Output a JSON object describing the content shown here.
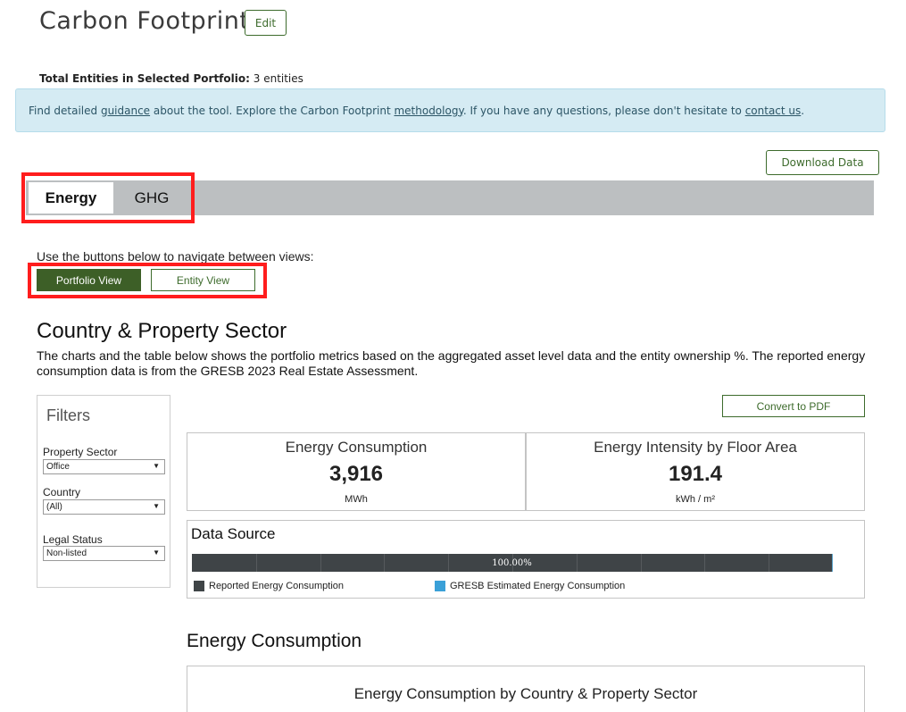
{
  "header": {
    "title": "Carbon Footprint",
    "edit_label": "Edit"
  },
  "summary": {
    "label": "Total Entities in Selected Portfolio:",
    "value": "3 entities"
  },
  "banner": {
    "t1": "Find detailed ",
    "link_guidance": "guidance",
    "t2": " about the tool. Explore the Carbon Footprint ",
    "link_methodology": "methodology",
    "t3": ". If you have any questions, please don't hesitate to ",
    "link_contact": "contact us",
    "t4": "."
  },
  "actions": {
    "download_label": "Download Data",
    "convert_label": "Convert to PDF"
  },
  "tabs": [
    {
      "label": "Energy",
      "active": true
    },
    {
      "label": "GHG",
      "active": false
    }
  ],
  "views": {
    "hint": "Use the buttons below to navigate between views:",
    "portfolio_label": "Portfolio View",
    "entity_label": "Entity View"
  },
  "section": {
    "title": "Country & Property Sector",
    "description": "The charts and the table below shows the portfolio metrics based on the aggregated asset level data and the entity ownership %. The reported energy consumption data is from the GRESB 2023 Real Estate Assessment."
  },
  "filters": {
    "title": "Filters",
    "items": [
      {
        "label": "Property Sector",
        "value": "Office"
      },
      {
        "label": "Country",
        "value": "(All)"
      },
      {
        "label": "Legal Status",
        "value": "Non-listed"
      }
    ]
  },
  "kpis": [
    {
      "title": "Energy Consumption",
      "value": "3,916",
      "unit": "MWh"
    },
    {
      "title": "Energy Intensity by Floor Area",
      "value": "191.4",
      "unit": "kWh / m²"
    }
  ],
  "data_source": {
    "title": "Data Source",
    "reported_pct": 100,
    "bar_label": "100.00%",
    "legend": [
      {
        "label": "Reported Energy Consumption",
        "color": "#3f4447"
      },
      {
        "label": "GRESB Estimated Energy Consumption",
        "color": "#3aa0d8"
      }
    ]
  },
  "energy_section": {
    "title": "Energy Consumption",
    "chart_title": "Energy Consumption by Country & Property Sector"
  },
  "colors": {
    "accent_green": "#3d6b2c",
    "highlight_red": "#ff1d1d",
    "banner_bg": "#d5ebf3"
  }
}
